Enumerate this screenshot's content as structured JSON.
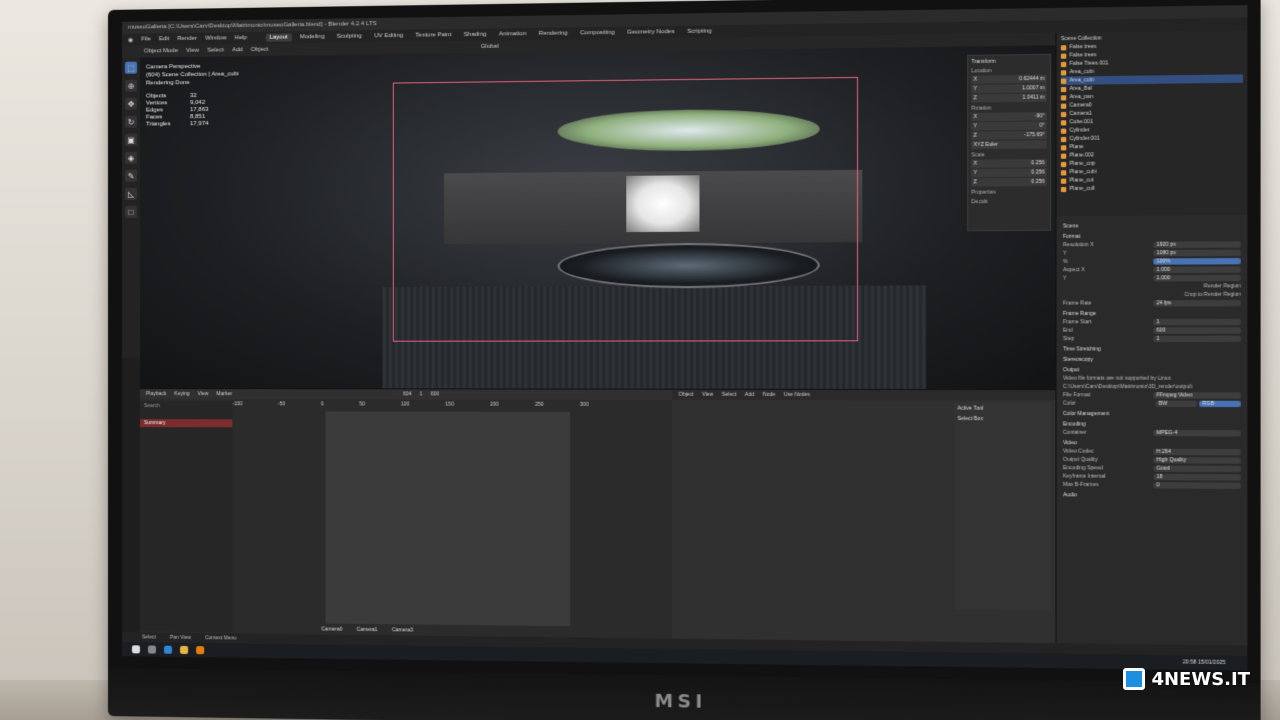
{
  "window": {
    "title": "museoGalleria [C:\\Users\\Carv\\Desktop\\Matrimonio\\museoGalleria.blend] - Blender 4.2.4 LTS"
  },
  "menu": [
    "File",
    "Edit",
    "Render",
    "Window",
    "Help"
  ],
  "workspaces": [
    "Layout",
    "Modeling",
    "Sculpting",
    "UV Editing",
    "Texture Paint",
    "Shading",
    "Animation",
    "Rendering",
    "Compositing",
    "Geometry Nodes",
    "Scripting"
  ],
  "toolbar": {
    "mode": "Object Mode",
    "items": [
      "View",
      "Select",
      "Add",
      "Object"
    ],
    "transform": "Global"
  },
  "viewport": {
    "info": [
      "Camera Perspective",
      "(604) Scene Collection | Area_cubi",
      "Rendering Done"
    ],
    "stats": [
      {
        "k": "Objects",
        "v": "32"
      },
      {
        "k": "Vertices",
        "v": "9,042"
      },
      {
        "k": "Edges",
        "v": "17,863"
      },
      {
        "k": "Faces",
        "v": "8,851"
      },
      {
        "k": "Triangles",
        "v": "17,974"
      }
    ]
  },
  "npanel": {
    "title": "Transform",
    "location_label": "Location",
    "location": [
      "0.62444 m",
      "1.0007 m",
      "1.0411 m"
    ],
    "rotation_label": "Rotation",
    "rotation": [
      "-90°",
      "0°",
      "-175.69°"
    ],
    "euler": "XYZ Euler",
    "scale_label": "Scale",
    "scale": [
      "0.256",
      "0.256",
      "0.256"
    ],
    "properties": "Properties",
    "decals": "Decals"
  },
  "outliner": {
    "title": "Scene Collection",
    "rows": [
      "Scene Collection",
      "False trees",
      "False trees",
      "False Trees.001",
      "Area_cubi",
      "Area_cubi",
      "Area_Bal",
      "Area_pan",
      "Camera0",
      "Camera1",
      "Cube.001",
      "Cylinder",
      "Cylinder.001",
      "Plane",
      "Plane.002",
      "Plane_cop",
      "Plane_cubi",
      "Plane_cut",
      "Plane_cull"
    ],
    "selected_index": 5
  },
  "properties": {
    "scene": "Scene",
    "format": "Format",
    "resolution_x": "1920 px",
    "resolution_y": "1080 px",
    "percent": "100%",
    "aspect_x": "1.000",
    "aspect_y": "1.000",
    "render_region": "Render Region",
    "crop": "Crop to Render Region",
    "frame_rate": "24 fps",
    "frame_range": "Frame Range",
    "frame_start": "1",
    "frame_end": "600",
    "step": "1",
    "time_stretching": "Time Stretching",
    "stereoscopy": "Stereoscopy",
    "output": "Output",
    "output_msg": "Video file formats are not supported by Linux",
    "output_path": "C:\\Users\\Carv\\Desktop\\Matrimonio\\3D_render\\output\\",
    "file_format": "FFmpeg Video",
    "color": [
      "BW",
      "RGB"
    ],
    "color_management": "Color Management",
    "encoding": "Encoding",
    "container": "MPEG-4",
    "video": "Video",
    "video_codec": "H.264",
    "output_quality": "High Quality",
    "encoding_speed": "Good",
    "keyframe_interval": "18",
    "max_b_frames": "0",
    "audio": "Audio"
  },
  "timeline": {
    "menus": [
      "Playback",
      "Keying",
      "View",
      "Marker"
    ],
    "ticks": [
      "-100",
      "-50",
      "0",
      "50",
      "100",
      "150",
      "200",
      "250",
      "300"
    ],
    "summary": "Summary",
    "search": "Search",
    "start": "1",
    "end": "600",
    "current": "604",
    "markers": [
      "Camera0",
      "Camera1",
      "Camera3"
    ]
  },
  "node_editor": {
    "menus": [
      "Object",
      "View",
      "Select",
      "Add",
      "Node",
      "Use Nodes"
    ],
    "active_tool": "Active Tool",
    "select_box": "Select Box"
  },
  "statusbar": [
    "Select",
    "Pan View",
    "Context Menu"
  ],
  "taskbar": {
    "time": "20:58",
    "date": "15/01/2025"
  },
  "monitor_brand": "MSI",
  "watermark": "4NEWS.IT"
}
